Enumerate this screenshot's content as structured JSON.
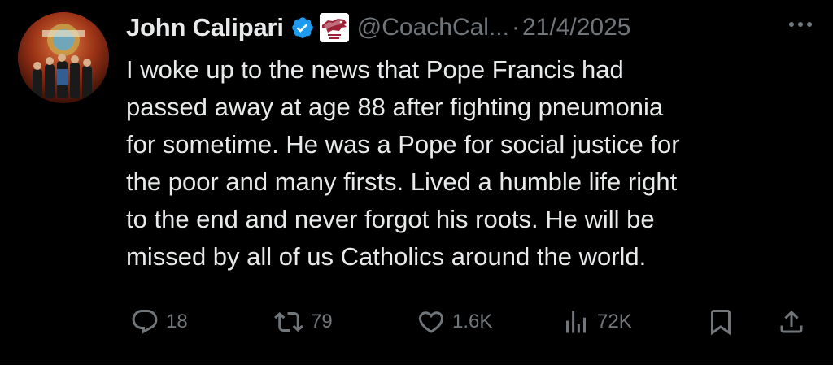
{
  "tweet": {
    "author_name": "John Calipari",
    "handle": "@CoachCal...",
    "separator": "·",
    "date": "21/4/2025",
    "lines": [
      "I woke up to the news that Pope Francis had",
      "passed away at age 88 after fighting pneumonia",
      "for sometime. He was a Pope for social justice for",
      "the poor and many firsts. Lived a humble life right",
      "to the end and never forgot his roots. He will be",
      "missed by all of us Catholics around the world."
    ],
    "icons": {
      "verified": "verified-badge-icon",
      "affiliation": "arkansas-razorbacks-logo",
      "more": "more-options-icon"
    }
  },
  "actions": {
    "replies": {
      "icon": "reply-icon",
      "count": "18"
    },
    "reposts": {
      "icon": "repost-icon",
      "count": "79"
    },
    "likes": {
      "icon": "like-icon",
      "count": "1.6K"
    },
    "views": {
      "icon": "views-icon",
      "count": "72K"
    },
    "bookmark": {
      "icon": "bookmark-icon"
    },
    "share": {
      "icon": "share-icon"
    }
  },
  "colors": {
    "background": "#000000",
    "text": "#e7e9ea",
    "secondary": "#71767b",
    "verified": "#1d9bf0"
  }
}
